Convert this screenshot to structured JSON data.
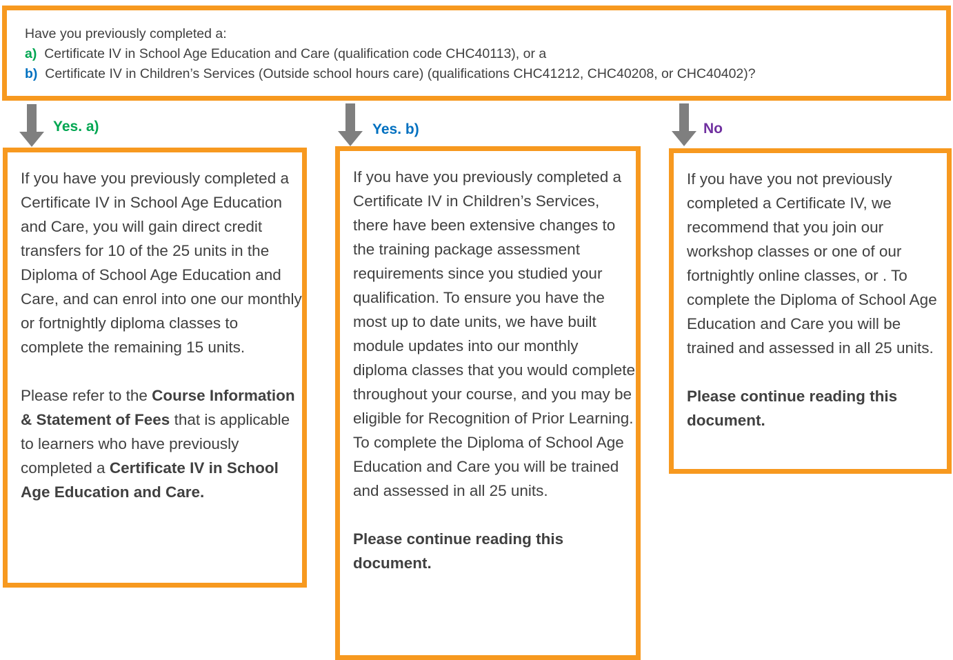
{
  "colors": {
    "border": "#f7991f",
    "arrow": "#7f7f7f",
    "option_a": "#00a651",
    "option_b": "#0070c0",
    "option_no": "#7030a0",
    "text": "#404040"
  },
  "question": {
    "intro": "Have you previously completed a:",
    "option_a_letter": "a)",
    "option_a_text": "Certificate IV in School Age Education and Care (qualification code CHC40113), or a",
    "option_b_letter": "b)",
    "option_b_text": "Certificate IV in Children’s Services (Outside school hours care) (qualifications CHC41212, CHC40208, or CHC40402)?"
  },
  "branches": {
    "a": {
      "label": "Yes. a)",
      "arrow_icon": "arrow-down-icon",
      "paragraph1": "If you have you previously completed a Certificate IV in School Age Education and Care, you will gain direct credit transfers for 10 of the 25 units in the Diploma of School Age Education and Care, and can enrol into one our monthly or fortnightly diploma classes to complete the remaining 15 units.",
      "p2_pre": "Please refer to the ",
      "p2_bold1": "Course Information & Statement of Fees",
      "p2_mid": " that is applicable to learners who have previously completed a ",
      "p2_bold2": "Certificate IV in School Age Education and Care."
    },
    "b": {
      "label": "Yes. b)",
      "arrow_icon": "arrow-down-icon",
      "paragraph1": "If you have you previously completed a Certificate IV in Children’s Services, there have been extensive changes to the training package assessment requirements since you studied your qualification. To ensure you have the most up to date units, we have built module updates into our monthly diploma classes that you would complete throughout your course, and you may be eligible for Recognition of Prior Learning.  To complete the Diploma of School Age Education and Care you will be trained and assessed in all 25 units.",
      "paragraph2": "Please continue reading this document."
    },
    "no": {
      "label": "No",
      "arrow_icon": "arrow-down-icon",
      "paragraph1": "If you have you not previously completed a Certificate IV, we recommend that you join our workshop classes or one of our fortnightly online classes, or  .  To complete the Diploma of School Age Education and Care you will be trained and assessed in all 25 units.",
      "paragraph2": "Please continue reading this document."
    }
  }
}
